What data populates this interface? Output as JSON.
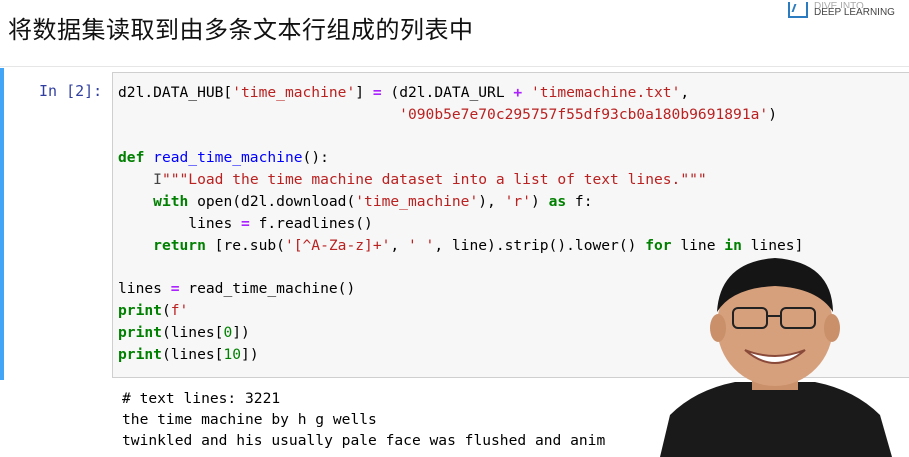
{
  "slide": {
    "title": "将数据集读取到由多条文本行组成的列表中"
  },
  "logo": {
    "top_text": "DIVE INTO",
    "text": "DEEP LEARNING"
  },
  "cell": {
    "prompt": "In [2]:",
    "code": {
      "l1": {
        "a": "d2l.DATA_HUB[",
        "b": "'time_machine'",
        "c": "] ",
        "d": "=",
        "e": " (d2l.DATA_URL ",
        "f": "+",
        "g": " ",
        "h": "'timemachine.txt'",
        "i": ","
      },
      "l2": {
        "pad": "                                ",
        "a": "'090b5e7e70c295757f55df93cb0a180b9691891a'",
        "b": ")"
      },
      "l4": {
        "kw": "def",
        "sp": " ",
        "fn": "read_time_machine",
        "rest": "():"
      },
      "l5": {
        "pad": "    ",
        "cursor": "I",
        "doc": "\"\"\"Load the time machine dataset into a list of text lines.\"\"\""
      },
      "l6": {
        "pad": "    ",
        "kw": "with",
        "a": " open(d2l.download(",
        "s1": "'time_machine'",
        "b": "), ",
        "s2": "'r'",
        "c": ") ",
        "kw2": "as",
        "d": " f:"
      },
      "l7": {
        "pad": "        ",
        "a": "lines ",
        "op": "=",
        "b": " f.readlines()"
      },
      "l8": {
        "pad": "    ",
        "kw": "return",
        "a": " [re.sub(",
        "s1": "'[^A-Za-z]+'",
        "b": ", ",
        "s2": "' '",
        "c": ", line).strip().lower() ",
        "kw2": "for",
        "d": " line ",
        "kw3": "in",
        "e": " lines]"
      },
      "l10": {
        "a": "lines ",
        "op": "=",
        "b": " read_time_machine()"
      },
      "l11": {
        "kw": "print",
        "a": "(",
        "s": "f'"
      },
      "l12": {
        "kw": "print",
        "a": "(lines[",
        "n": "0",
        "b": "])"
      },
      "l13": {
        "kw": "print",
        "a": "(lines[",
        "n": "10",
        "b": "])"
      }
    }
  },
  "output": {
    "lines": [
      "# text lines: 3221",
      "the time machine by h g wells",
      "twinkled and his usually pale face was flushed and anim"
    ]
  }
}
